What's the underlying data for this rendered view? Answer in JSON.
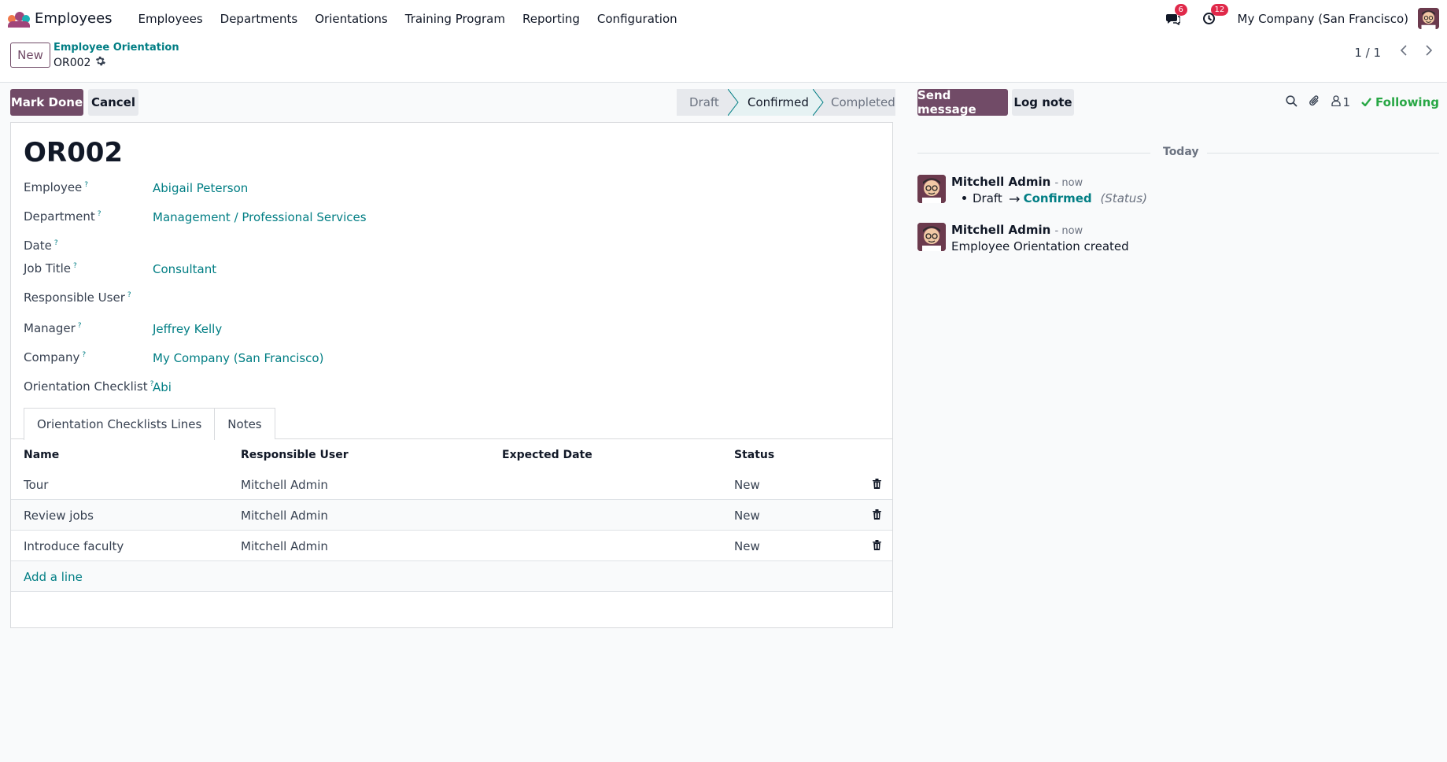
{
  "navbar": {
    "app_name": "Employees",
    "menu": [
      "Employees",
      "Departments",
      "Orientations",
      "Training Program",
      "Reporting",
      "Configuration"
    ],
    "messages_badge": "6",
    "activities_badge": "12",
    "company": "My Company (San Francisco)"
  },
  "control": {
    "new_label": "New",
    "breadcrumb": "Employee Orientation",
    "record_name": "OR002",
    "pager": "1 / 1"
  },
  "actions": {
    "mark_done": "Mark Done",
    "cancel": "Cancel"
  },
  "status": {
    "stages": [
      "Draft",
      "Confirmed",
      "Completed"
    ],
    "current": "Confirmed"
  },
  "form": {
    "title": "OR002",
    "fields": [
      {
        "label": "Employee",
        "value": "Abigail Peterson"
      },
      {
        "label": "Department",
        "value": "Management / Professional Services"
      },
      {
        "label": "Date",
        "value": ""
      },
      {
        "label": "Job Title",
        "value": "Consultant"
      },
      {
        "label": "Responsible User",
        "value": ""
      },
      {
        "label": "Manager",
        "value": "Jeffrey Kelly"
      },
      {
        "label": "Company",
        "value": "My Company (San Francisco)"
      },
      {
        "label": "Orientation Checklist",
        "value": "Abi"
      }
    ],
    "help_mark": "?"
  },
  "tabs": [
    "Orientation Checklists Lines",
    "Notes"
  ],
  "table": {
    "columns": [
      "Name",
      "Responsible User",
      "Expected Date",
      "Status"
    ],
    "rows": [
      {
        "name": "Tour",
        "user": "Mitchell Admin",
        "date": "",
        "status": "New"
      },
      {
        "name": "Review jobs",
        "user": "Mitchell Admin",
        "date": "",
        "status": "New"
      },
      {
        "name": "Introduce faculty",
        "user": "Mitchell Admin",
        "date": "",
        "status": "New"
      }
    ],
    "add_line": "Add a line"
  },
  "chatter": {
    "send_message": "Send message",
    "log_note": "Log note",
    "followers_count": "1",
    "following": "Following",
    "day_separator": "Today",
    "messages": [
      {
        "author": "Mitchell Admin",
        "time": "- now",
        "tracking_old": "Draft",
        "tracking_new": "Confirmed",
        "tracking_field": "(Status)"
      },
      {
        "author": "Mitchell Admin",
        "time": "- now",
        "body": "Employee Orientation created"
      }
    ]
  },
  "colors": {
    "brand": "#714b67",
    "link": "#017e84",
    "badge": "#e0294a",
    "following": "#28a745"
  }
}
